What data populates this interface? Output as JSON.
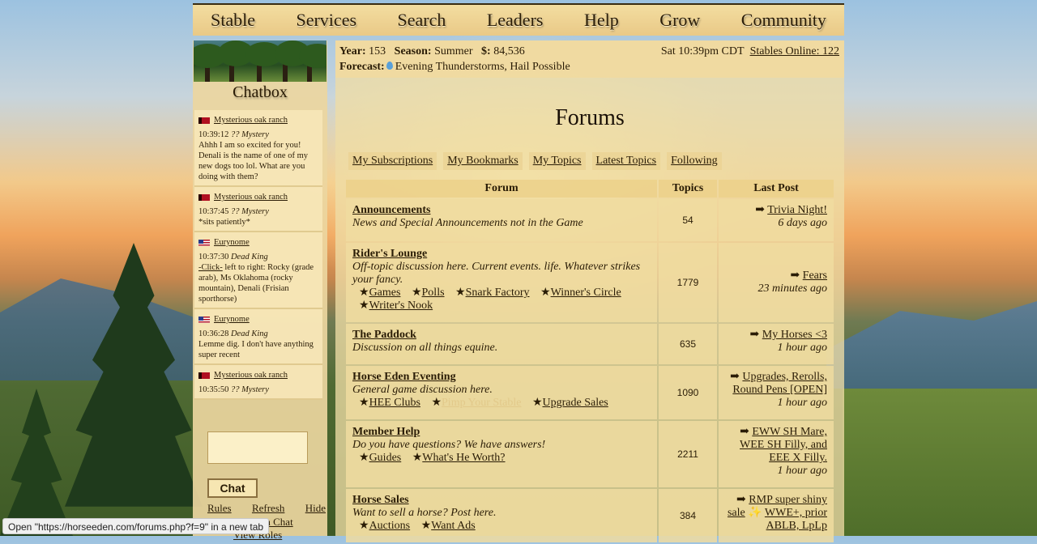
{
  "nav": [
    "Stable",
    "Services",
    "Search",
    "Leaders",
    "Help",
    "Grow",
    "Community"
  ],
  "sidebar": {
    "title": "Chatbox",
    "messages": [
      {
        "user": "Mysterious oak ranch",
        "flag": "red",
        "time": "10:39:12",
        "rank": "?? Mystery",
        "text": "Ahhh I am so excited for you! Denali is the name of one of my new dogs too lol. What are you doing with them?"
      },
      {
        "user": "Mysterious oak ranch",
        "flag": "red",
        "time": "10:37:45",
        "rank": "?? Mystery",
        "text": "*sits patiently*"
      },
      {
        "user": "Eurynome",
        "flag": "us",
        "time": "10:37:30",
        "rank": "Dead King",
        "link": "-Click-",
        "text": " left to right: Rocky (grade arab), Ms Oklahoma (rocky mountain), Denali (Frisian sporthorse)"
      },
      {
        "user": "Eurynome",
        "flag": "us",
        "time": "10:36:28",
        "rank": "Dead King",
        "text": "Lemme dig. I don't have anything super recent"
      },
      {
        "user": "Mysterious oak ranch",
        "flag": "red",
        "time": "10:35:50",
        "rank": "?? Mystery",
        "text": ""
      }
    ],
    "chat_button": "Chat",
    "links": [
      "Rules",
      "Refresh",
      "Hide"
    ],
    "main_chat": "ain Chat",
    "view_roles": "View Roles"
  },
  "info": {
    "year_label": "Year:",
    "year": "153",
    "season_label": "Season:",
    "season": "Summer",
    "money_label": "$:",
    "money": "84,536",
    "forecast_label": "Forecast:",
    "forecast": "Evening Thunderstorms, Hail Possible",
    "time": "Sat 10:39pm CDT",
    "online": "Stables Online: 122"
  },
  "page_title": "Forums",
  "tabs": [
    "My Subscriptions",
    "My Bookmarks",
    "My Topics",
    "Latest Topics",
    "Following"
  ],
  "table": {
    "headers": [
      "Forum",
      "Topics",
      "Last Post"
    ],
    "rows": [
      {
        "name": "Announcements",
        "desc": "News and Special Announcements not in the Game",
        "subs": [],
        "topics": "54",
        "last": "Trivia Night!",
        "when": "6 days ago"
      },
      {
        "name": "Rider's Lounge",
        "desc": "Off-topic discussion here. Current events. life. Whatever strikes your fancy.",
        "subs": [
          "Games",
          "Polls",
          "Snark Factory",
          "Winner's Circle",
          "Writer's Nook"
        ],
        "topics": "1779",
        "last": "Fears",
        "when": "23 minutes ago"
      },
      {
        "name": "The Paddock",
        "desc": "Discussion on all things equine.",
        "subs": [],
        "topics": "635",
        "last": "My Horses <3",
        "when": "1 hour ago"
      },
      {
        "name": "Horse Eden Eventing",
        "desc": "General game discussion here.",
        "subs": [
          "HEE Clubs",
          "Pimp Your Stable",
          "Upgrade Sales"
        ],
        "topics": "1090",
        "last": "Upgrades, Rerolls, Round Pens [OPEN]",
        "when": "1 hour ago"
      },
      {
        "name": "Member Help",
        "desc": "Do you have questions? We have answers!",
        "subs": [
          "Guides",
          "What's He Worth?"
        ],
        "topics": "2211",
        "last": "EWW SH Mare, WEE SH Filly, and EEE X Filly.",
        "when": "1 hour ago"
      },
      {
        "name": "Horse Sales",
        "desc": "Want to sell a horse? Post here.",
        "subs": [
          "Auctions",
          "Want Ads"
        ],
        "topics": "384",
        "last": "RMP super shiny sale",
        "last_extra": "WWE+, prior ABLB, LpLp",
        "when": ""
      }
    ]
  },
  "status_url": "Open \"https://horseeden.com/forums.php?f=9\" in a new tab"
}
